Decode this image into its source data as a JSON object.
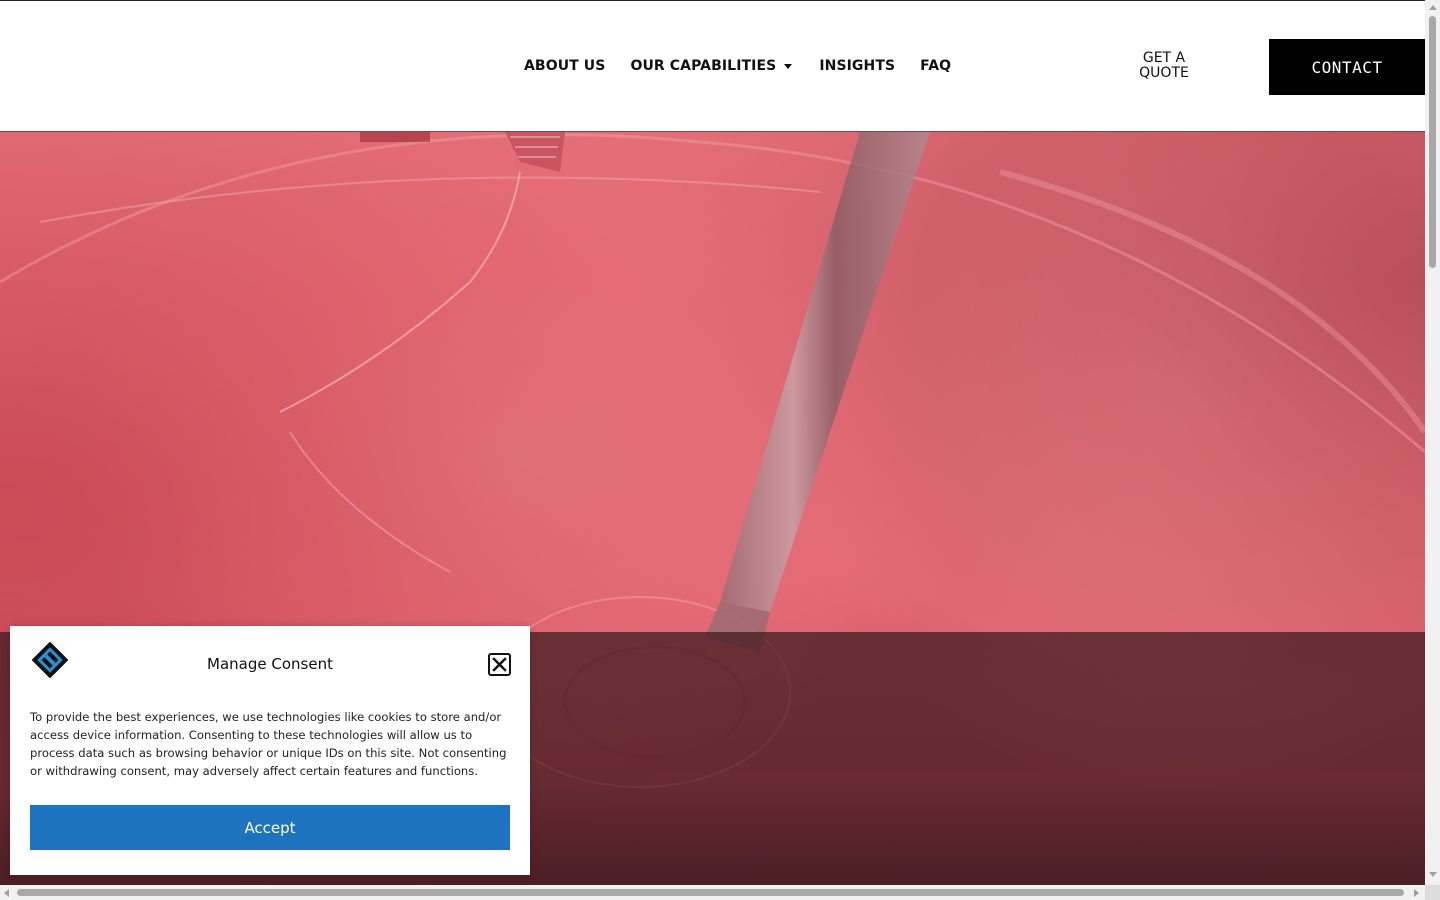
{
  "header": {
    "nav": {
      "about": "ABOUT US",
      "capabilities": "OUR CAPABILITIES",
      "insights": "INSIGHTS",
      "faq": "FAQ"
    },
    "quote_label": "GET A\nQUOTE",
    "contact_label": "CONTACT"
  },
  "hero": {
    "image": "pink paint mixing with metal stirrer",
    "colors": {
      "paint": "#e46e78",
      "overlay": "#3c191e"
    }
  },
  "consent": {
    "title": "Manage Consent",
    "body": "To provide the best experiences, we use technologies like cookies to store and/or access device information. Consenting to these technologies will allow us to process data such as browsing behavior or unique IDs on this site. Not consenting or withdrawing consent, may adversely affect certain features and functions.",
    "accept_label": "Accept",
    "close_icon": "close-icon",
    "accent": "#1e73be"
  }
}
